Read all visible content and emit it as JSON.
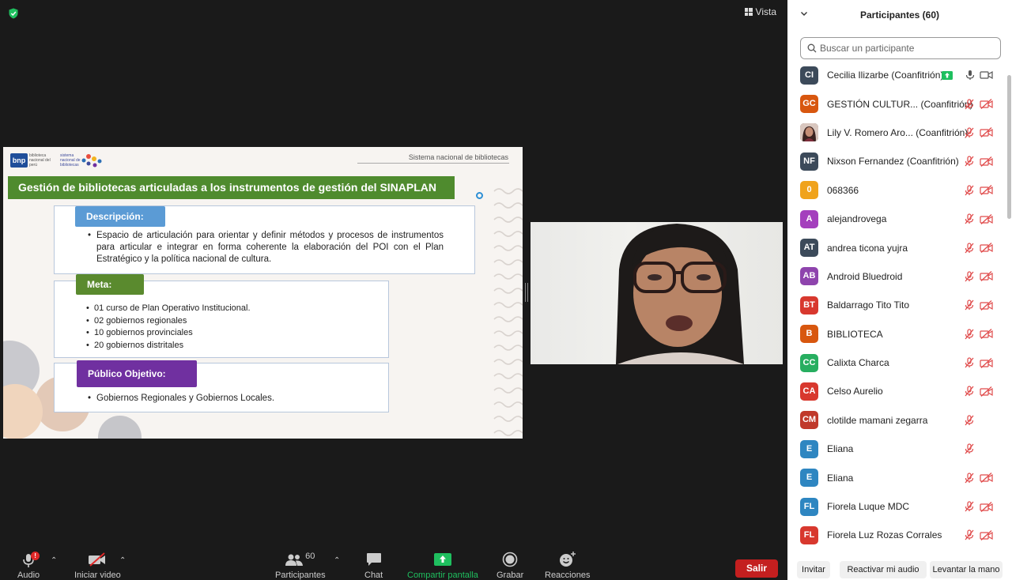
{
  "view_label": "Vista",
  "slide": {
    "bnp_logo": "bnp",
    "bnp_logo_text": "biblioteca nacional del perú",
    "sn_logo_text": "sistema nacional de bibliotecas",
    "system_label": "Sistema nacional de bibliotecas",
    "title": "Gestión de bibliotecas articuladas a los instrumentos de gestión del SINAPLAN",
    "description_tag": "Descripción:",
    "description_items": [
      "Espacio de articulación para orientar y definir métodos y procesos de instrumentos para articular e integrar en forma coherente la elaboración del POI con el Plan Estratégico y la política nacional de cultura."
    ],
    "meta_tag": "Meta:",
    "meta_items": [
      "01 curso de Plan Operativo Institucional.",
      "02 gobiernos regionales",
      "10 gobiernos provinciales",
      "20 gobiernos distritales"
    ],
    "public_tag": "Público Objetivo:",
    "public_items": [
      "Gobiernos Regionales y Gobiernos Locales."
    ]
  },
  "toolbar": {
    "audio_label": "Audio",
    "audio_badge": "!",
    "video_label": "Iniciar video",
    "participants_label": "Participantes",
    "participants_count": "60",
    "chat_label": "Chat",
    "share_label": "Compartir pantalla",
    "record_label": "Grabar",
    "reactions_label": "Reacciones",
    "leave_label": "Salir"
  },
  "panel": {
    "title": "Participantes (60)",
    "search_placeholder": "Buscar un participante",
    "participants": [
      {
        "initials": "CI",
        "name": "Cecilia Ilizarbe (Coanfitrión)",
        "color": "#3c4a5a",
        "status": "host"
      },
      {
        "initials": "GC",
        "name": "GESTIÓN CULTUR...  (Coanfitrión)",
        "color": "#d8570f",
        "status": "muted"
      },
      {
        "initials": "",
        "name": "Lily V. Romero Aro... (Coanfitrión)",
        "color": "#6b4a3e",
        "status": "muted",
        "photo": true
      },
      {
        "initials": "NF",
        "name": "Nixson Fernandez (Coanfitrión)",
        "color": "#3c4a5a",
        "status": "muted"
      },
      {
        "initials": "0",
        "name": "068366",
        "color": "#f0a31c",
        "status": "muted"
      },
      {
        "initials": "A",
        "name": "alejandrovega",
        "color": "#a43fbd",
        "status": "muted"
      },
      {
        "initials": "AT",
        "name": "andrea ticona yujra",
        "color": "#3c4a5a",
        "status": "muted"
      },
      {
        "initials": "AB",
        "name": "Android Bluedroid",
        "color": "#8e44ad",
        "status": "muted"
      },
      {
        "initials": "BT",
        "name": "Baldarrago Tito Tito",
        "color": "#d8382e",
        "status": "muted"
      },
      {
        "initials": "B",
        "name": "BIBLIOTECA",
        "color": "#d8570f",
        "status": "muted"
      },
      {
        "initials": "CC",
        "name": "Calixta Charca",
        "color": "#27ae60",
        "status": "muted"
      },
      {
        "initials": "CA",
        "name": "Celso Aurelio",
        "color": "#d8382e",
        "status": "muted"
      },
      {
        "initials": "CM",
        "name": "clotilde mamani zegarra",
        "color": "#c0392b",
        "status": "mic-only"
      },
      {
        "initials": "E",
        "name": "Eliana",
        "color": "#2e86c1",
        "status": "mic-only"
      },
      {
        "initials": "E",
        "name": "Eliana",
        "color": "#2e86c1",
        "status": "muted"
      },
      {
        "initials": "FL",
        "name": "Fiorela Luque MDC",
        "color": "#2e86c1",
        "status": "muted"
      },
      {
        "initials": "FL",
        "name": "Fiorela Luz Rozas Corrales",
        "color": "#d8382e",
        "status": "muted"
      }
    ],
    "invite_label": "Invitar",
    "unmute_label": "Reactivar mi audio",
    "raise_hand_label": "Levantar la mano"
  },
  "colors": {
    "title_green": "#4f8b2e",
    "desc_blue": "#5b9bd5",
    "meta_green": "#5a8a2e",
    "public_purple": "#7030a0",
    "leave_red": "#c41f1f",
    "share_green": "#1fbf5f",
    "muted_red": "#e04b4b"
  }
}
